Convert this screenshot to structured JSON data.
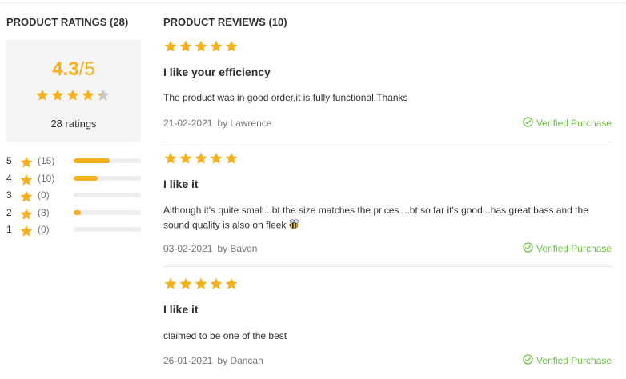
{
  "ratings": {
    "title": "PRODUCT RATINGS (28)",
    "average": "4.3",
    "slash": "/",
    "out_of": "5",
    "count_label": "28 ratings",
    "average_value": 4.3,
    "distribution": [
      {
        "stars": "5",
        "count": "(15)",
        "fraction": 0.54
      },
      {
        "stars": "4",
        "count": "(10)",
        "fraction": 0.36
      },
      {
        "stars": "3",
        "count": "(0)",
        "fraction": 0
      },
      {
        "stars": "2",
        "count": "(3)",
        "fraction": 0.11
      },
      {
        "stars": "1",
        "count": "(0)",
        "fraction": 0
      }
    ]
  },
  "reviews": {
    "title": "PRODUCT REVIEWS (10)",
    "verified_label": "Verified Purchase",
    "items": [
      {
        "rating": 5,
        "title": "I like your efficiency",
        "body": "The product was in good order,it is fully functional.Thanks",
        "date": "21-02-2021",
        "author": "by Lawrence",
        "emoji": ""
      },
      {
        "rating": 5,
        "title": "I like it",
        "body": "Although it's quite small...bt the size matches the prices....bt so far it's good...has great bass and the sound quality is also on fleek",
        "date": "03-02-2021",
        "author": "by Bavon",
        "emoji": "bee-emoji"
      },
      {
        "rating": 5,
        "title": "I like it",
        "body": "claimed to be one of the best",
        "date": "26-01-2021",
        "author": "by Dancan",
        "emoji": ""
      }
    ]
  },
  "colors": {
    "star": "#f6b01e",
    "star_empty": "#c8c8c8",
    "verified": "#6cbe45",
    "bar_track": "#eeeeee"
  }
}
